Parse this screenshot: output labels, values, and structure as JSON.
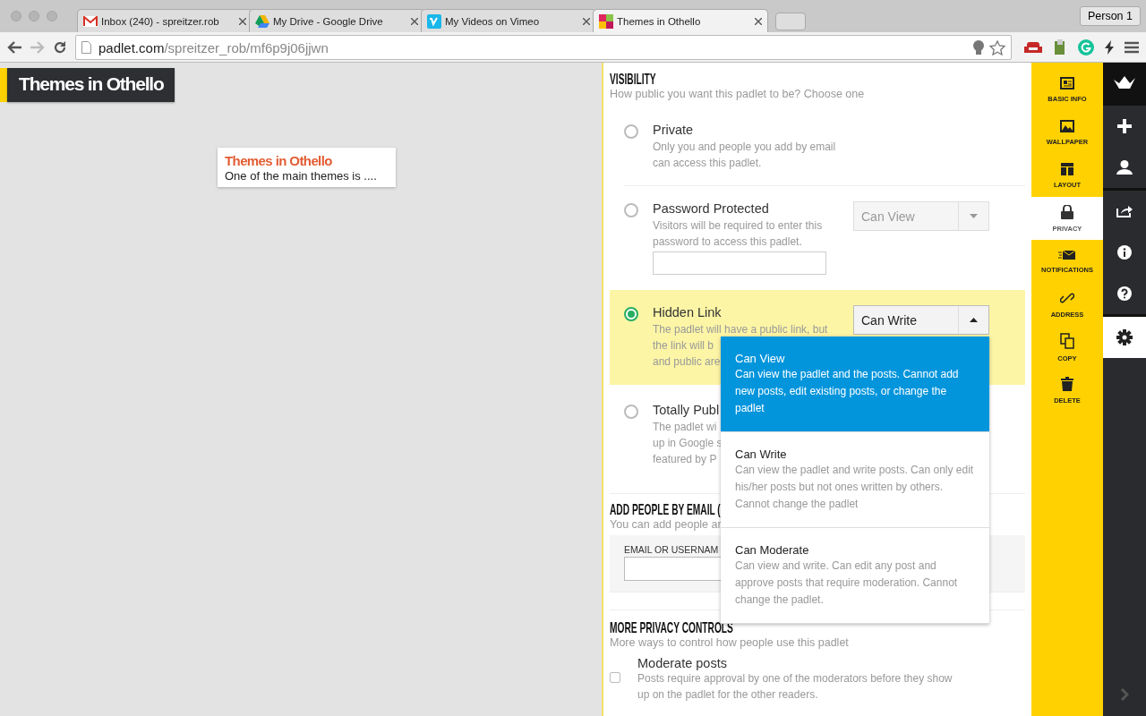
{
  "browser": {
    "tabs": [
      {
        "title": "Inbox (240) - spreitzer.rob",
        "kind": "mail",
        "selected": false
      },
      {
        "title": "My Drive - Google Drive",
        "kind": "drive",
        "selected": false
      },
      {
        "title": "My Videos on Vimeo",
        "kind": "video",
        "selected": false
      },
      {
        "title": "Themes in Othello",
        "kind": "board",
        "selected": true
      }
    ],
    "profile": "Person 1",
    "url": {
      "host": "padlet.com",
      "path": "/spreitzer_rob/mf6p9j06jjwn"
    }
  },
  "canvas": {
    "title": "Themes in Othello",
    "post": {
      "title": "Themes in Othello",
      "body": "One of the main themes is ...."
    }
  },
  "visibility": {
    "heading": "VISIBILITY",
    "subtitle": "How public you want this padlet to be? Choose one",
    "options": [
      {
        "label": "Private",
        "description": "Only you and people you add by email\ncan access this padlet.",
        "selected": false
      },
      {
        "label": "Password Protected",
        "description": "Visitors will be required to enter this\npassword to access this padlet.",
        "selected": false,
        "password_field": true,
        "permission": {
          "value": "Can View",
          "expanded": false
        }
      },
      {
        "label": "Hidden Link",
        "description": "The padlet will have a public link, but\nthe link will b\nand public are",
        "selected": true,
        "permission": {
          "value": "Can Write",
          "expanded": true
        }
      },
      {
        "label": "Totally Publ",
        "description": "The padlet wi\nup in Google s\nfeatured by P",
        "selected": false
      }
    ]
  },
  "permission_menu": [
    {
      "label": "Can View",
      "description": "Can view the padlet and the posts. Cannot add new posts, edit existing posts, or change the padlet",
      "selected": true
    },
    {
      "label": "Can Write",
      "description": "Can view the padlet and write posts. Can only edit his/her posts but not ones written by others. Cannot change the padlet",
      "selected": false
    },
    {
      "label": "Can Moderate",
      "description": "Can view and write. Can edit any post and approve posts that require moderation. Cannot change the padlet.",
      "selected": false
    }
  ],
  "add_people": {
    "heading": "ADD PEOPLE BY EMAIL (",
    "subtitle": "You can add people ar",
    "field_label": "EMAIL OR USERNAM"
  },
  "more_privacy": {
    "heading": "MORE PRIVACY CONTROLS",
    "subtitle": "More ways to control how people use this padlet",
    "items": [
      {
        "label": "Moderate posts",
        "description": "Posts require approval by one of the moderators before they show\nup on the padlet for the other readers.",
        "checked": false
      }
    ]
  },
  "settings_sidebar": [
    {
      "label": "BASIC INFO",
      "kind": "card",
      "selected": false
    },
    {
      "label": "WALLPAPER",
      "kind": "image",
      "selected": false
    },
    {
      "label": "LAYOUT",
      "kind": "layout",
      "selected": false
    },
    {
      "label": "PRIVACY",
      "kind": "lock",
      "selected": true
    },
    {
      "label": "NOTIFICATIONS",
      "kind": "envelope",
      "selected": false
    },
    {
      "label": "ADDRESS",
      "kind": "link",
      "selected": false
    },
    {
      "label": "COPY",
      "kind": "copy",
      "selected": false
    },
    {
      "label": "DELETE",
      "kind": "trash",
      "selected": false
    }
  ],
  "tool_rail": [
    {
      "kind": "logo",
      "selected": false
    },
    {
      "kind": "plus",
      "selected": false
    },
    {
      "kind": "person",
      "selected": false
    },
    {
      "kind": "share",
      "selected": false
    },
    {
      "kind": "info",
      "selected": false
    },
    {
      "kind": "help",
      "selected": false
    },
    {
      "kind": "gear",
      "selected": true
    },
    {
      "kind": "chevron",
      "selected": false
    }
  ]
}
